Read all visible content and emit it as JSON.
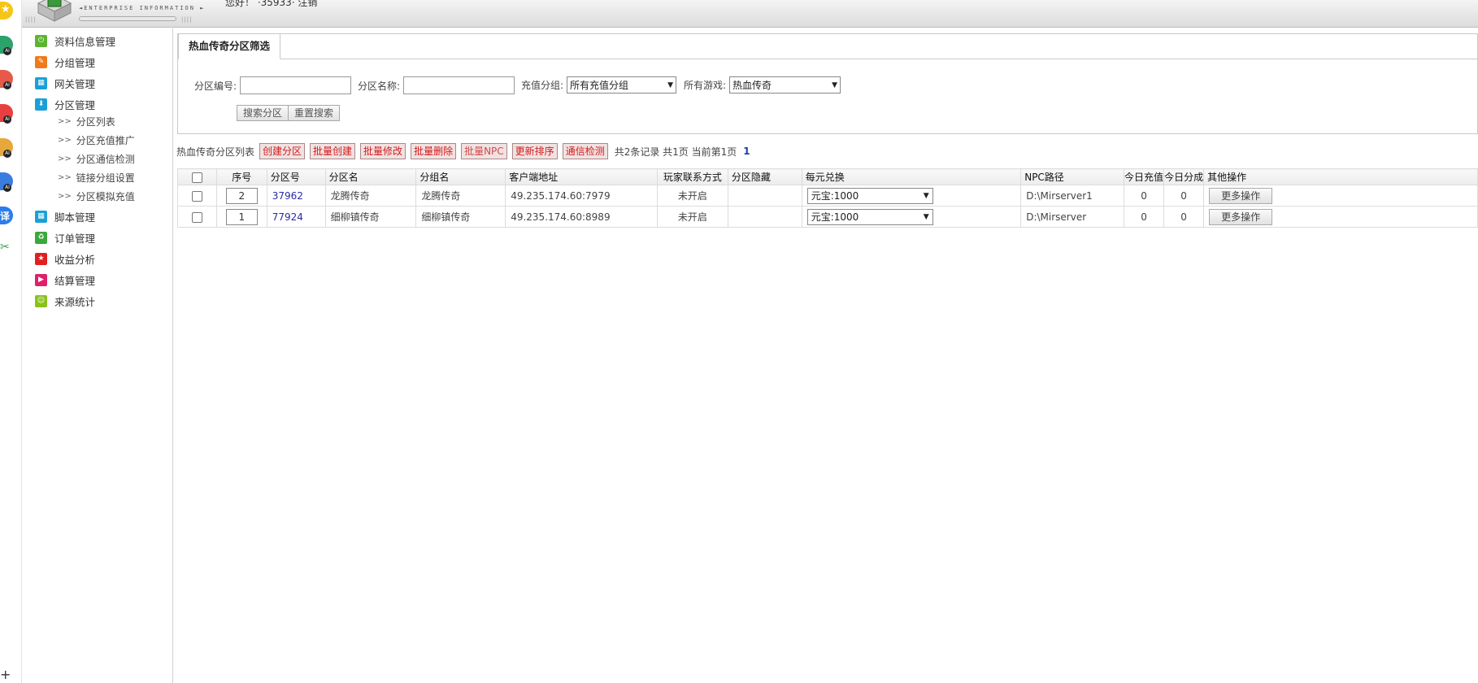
{
  "header": {
    "tagline": "◄ENTERPRISE INFORMATION ►",
    "ticks_left": "||||",
    "ticks_right": "||||",
    "user_text": "您好！ ·35933· 注销"
  },
  "sidebar": {
    "items": [
      {
        "label": "资料信息管理",
        "icon": "power-icon",
        "color": "#5cb531"
      },
      {
        "label": "分组管理",
        "icon": "pencil-icon",
        "color": "#f07a1a"
      },
      {
        "label": "网关管理",
        "icon": "grid-icon",
        "color": "#1aa0d8"
      },
      {
        "label": "分区管理",
        "icon": "download-icon",
        "color": "#1aa0d8"
      },
      {
        "label": "脚本管理",
        "icon": "grid-icon",
        "color": "#1aa0d8"
      },
      {
        "label": "订单管理",
        "icon": "recycle-icon",
        "color": "#3aa83a"
      },
      {
        "label": "收益分析",
        "icon": "star-icon",
        "color": "#e02020"
      },
      {
        "label": "结算管理",
        "icon": "play-icon",
        "color": "#e0206a"
      },
      {
        "label": "来源统计",
        "icon": "smile-icon",
        "color": "#8ac21a"
      }
    ],
    "sub_items": [
      {
        "label": "分区列表"
      },
      {
        "label": "分区充值推广"
      },
      {
        "label": "分区通信检测"
      },
      {
        "label": "链接分组设置"
      },
      {
        "label": "分区模拟充值"
      }
    ],
    "sub_arrow": ">>"
  },
  "filter": {
    "tab_title": "热血传奇分区筛选",
    "zone_no_label": "分区编号:",
    "zone_no_value": "",
    "zone_name_label": "分区名称:",
    "zone_name_value": "",
    "recharge_group_label": "充值分组:",
    "recharge_group_value": "所有充值分组",
    "game_label": "所有游戏:",
    "game_value": "热血传奇",
    "search_button": "搜索分区",
    "reset_button": "重置搜索"
  },
  "toolbar": {
    "title": "热血传奇分区列表",
    "buttons": [
      {
        "label": "创建分区"
      },
      {
        "label": "批量创建"
      },
      {
        "label": "批量修改"
      },
      {
        "label": "批量删除"
      },
      {
        "label": "批量NPC"
      },
      {
        "label": "更新排序"
      },
      {
        "label": "通信检测"
      }
    ],
    "stats": "共2条记录 共1页 当前第1页",
    "page_number": "1"
  },
  "table": {
    "columns": [
      "序号",
      "分区号",
      "分区名",
      "分组名",
      "客户端地址",
      "玩家联系方式",
      "分区隐藏",
      "每元兑换",
      "NPC路径",
      "今日充值",
      "今日分成",
      "其他操作"
    ],
    "rows": [
      {
        "seq": "2",
        "zone_no": "37962",
        "zone_name": "龙腾传奇",
        "group_name": "龙腾传奇",
        "client_addr": "49.235.174.60:7979",
        "contact": "未开启",
        "hidden": "",
        "exchange": "元宝:1000",
        "npc_path": "D:\\Mirserver1",
        "today_recharge": "0",
        "today_share": "0",
        "more": "更多操作"
      },
      {
        "seq": "1",
        "zone_no": "77924",
        "zone_name": "细柳镇传奇",
        "group_name": "细柳镇传奇",
        "client_addr": "49.235.174.60:8989",
        "contact": "未开启",
        "hidden": "",
        "exchange": "元宝:1000",
        "npc_path": "D:\\Mirserver",
        "today_recharge": "0",
        "today_share": "0",
        "more": "更多操作"
      }
    ]
  },
  "dock": {
    "icons": [
      {
        "name": "star-app-icon",
        "color": "#f5c518"
      },
      {
        "name": "ai-app-icon-1",
        "color": "#2ca36a"
      },
      {
        "name": "ai-app-icon-2",
        "color": "#e65a4a"
      },
      {
        "name": "ai-app-icon-3",
        "color": "#e84040"
      },
      {
        "name": "ai-app-icon-4",
        "color": "#e6a83a"
      },
      {
        "name": "ai-app-icon-5",
        "color": "#3a7de0"
      },
      {
        "name": "translate-app-icon",
        "color": "#2b7de9"
      },
      {
        "name": "scissors-app-icon",
        "color": "#3aa04a"
      }
    ],
    "ai_badge": "AI",
    "translate_glyph": "译",
    "add_glyph": "+"
  }
}
